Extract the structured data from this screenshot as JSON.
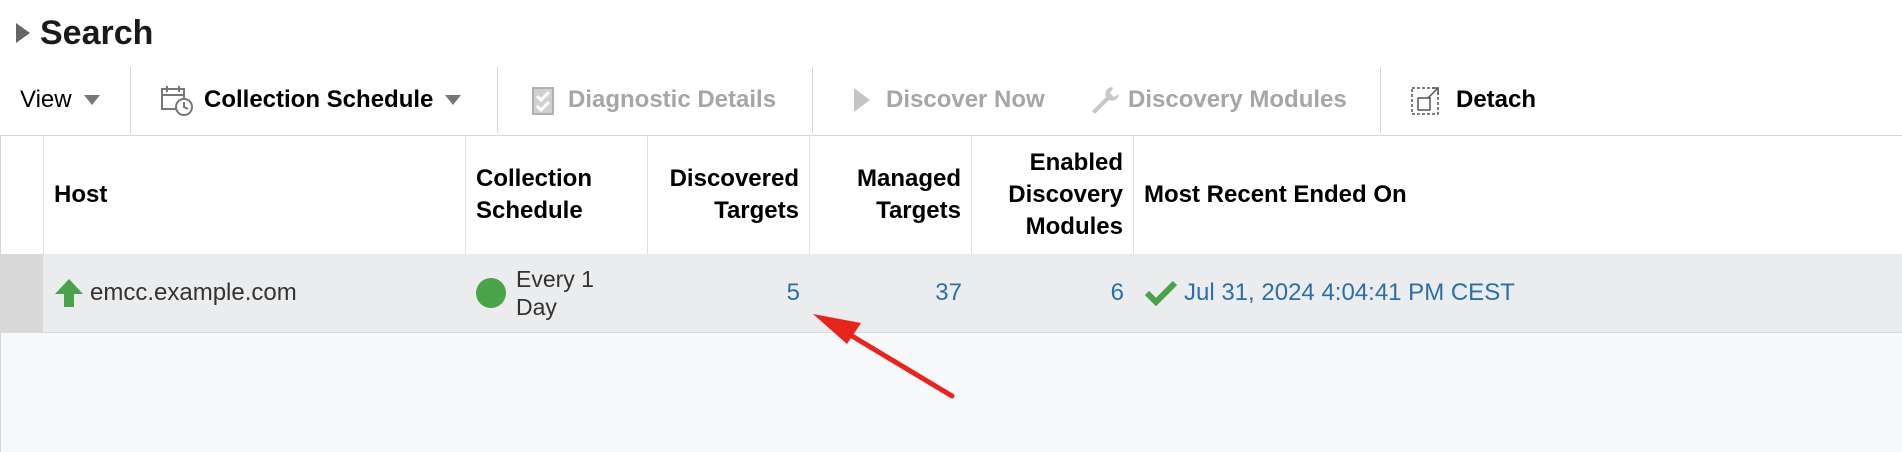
{
  "search": {
    "title": "Search"
  },
  "toolbar": {
    "view_label": "View",
    "collection_schedule_label": "Collection Schedule",
    "diagnostic_details_label": "Diagnostic Details",
    "discover_now_label": "Discover Now",
    "discovery_modules_label": "Discovery Modules",
    "detach_label": "Detach"
  },
  "table": {
    "columns": {
      "host": "Host",
      "collection_schedule": "Collection\nSchedule",
      "discovered_targets": "Discovered\nTargets",
      "managed_targets": "Managed\nTargets",
      "enabled_modules": "Enabled\nDiscovery\nModules",
      "most_recent": "Most Recent Ended On"
    },
    "rows": [
      {
        "host": "emcc.example.com",
        "status": "up",
        "schedule": "Every 1\nDay",
        "discovered_targets": "5",
        "managed_targets": "37",
        "enabled_modules": "6",
        "most_recent": "Jul 31, 2024 4:04:41 PM CEST"
      }
    ]
  },
  "colors": {
    "link": "#2a6fa8",
    "status_green": "#4aa24a",
    "annotation_arrow": "#e8251c"
  }
}
